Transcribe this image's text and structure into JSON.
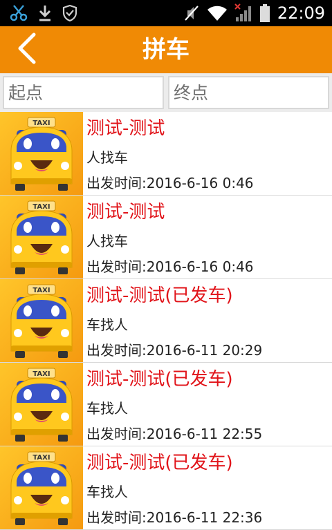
{
  "status_bar": {
    "time": "22:09",
    "icons": [
      "scissors-icon",
      "download-icon",
      "shield-icon",
      "mute-icon",
      "wifi-icon",
      "signal-icon",
      "battery-icon"
    ]
  },
  "header": {
    "title": "拼车",
    "back_icon": "chevron-left-icon"
  },
  "search": {
    "start_placeholder": "起点",
    "end_placeholder": "终点"
  },
  "rides": [
    {
      "title": "测试-测试",
      "type": "人找车",
      "time": "出发时间:2016-6-16 0:46"
    },
    {
      "title": "测试-测试",
      "type": "人找车",
      "time": "出发时间:2016-6-16 0:46"
    },
    {
      "title": "测试-测试(已发车)",
      "type": "车找人",
      "time": "出发时间:2016-6-11 20:29"
    },
    {
      "title": "测试-测试(已发车)",
      "type": "车找人",
      "time": "出发时间:2016-6-11 22:55"
    },
    {
      "title": "测试-测试(已发车)",
      "type": "车找人",
      "time": "出发时间:2016-6-11 22:36"
    }
  ],
  "taxi_sign": "TAXI",
  "colors": {
    "accent": "#f08a05",
    "title_red": "#e1141a",
    "taxi_yellow": "#ffc81e",
    "taxi_blue": "#3a55c8"
  }
}
